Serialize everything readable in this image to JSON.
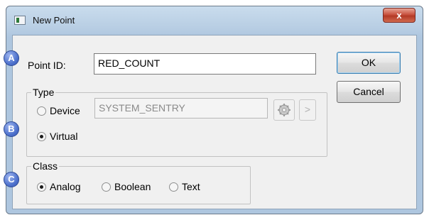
{
  "window": {
    "title": "New Point",
    "close_symbol": "x"
  },
  "point_id": {
    "label": "Point ID:",
    "value": "RED_COUNT"
  },
  "buttons": {
    "ok": "OK",
    "cancel": "Cancel"
  },
  "type_group": {
    "legend": "Type",
    "device_label": "Device",
    "device_value": "SYSTEM_SENTRY",
    "virtual_label": "Virtual",
    "selected": "Virtual",
    "browse_symbol": ">"
  },
  "class_group": {
    "legend": "Class",
    "options": [
      "Analog",
      "Boolean",
      "Text"
    ],
    "selected": "Analog"
  },
  "callouts": [
    "A",
    "B",
    "C"
  ],
  "colors": {
    "accent": "#3c7fb1",
    "callout": "#4b6fcb",
    "close": "#c8523f"
  },
  "icons": {
    "app": "window-icon",
    "config": "gear-icon"
  }
}
